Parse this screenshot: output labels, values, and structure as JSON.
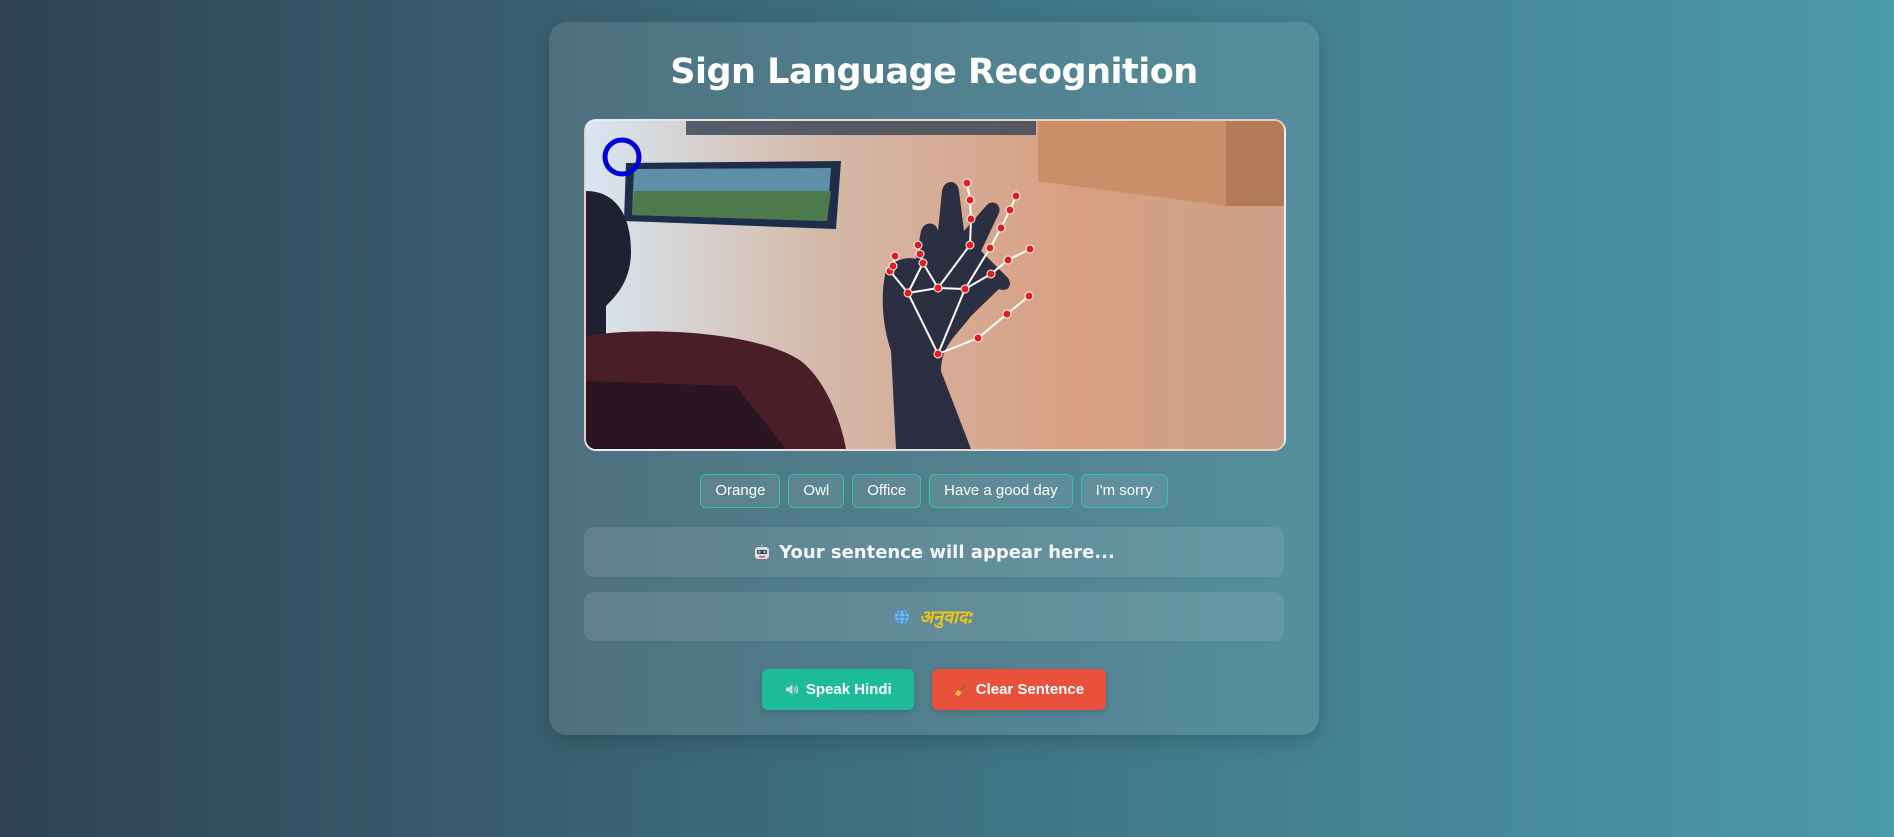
{
  "app": {
    "title": "Sign Language Recognition"
  },
  "video": {
    "indicator_icon": "ring-indicator-icon",
    "content_icon": "hand-landmarks-icon"
  },
  "word_buttons": [
    {
      "label": "Orange"
    },
    {
      "label": "Owl"
    },
    {
      "label": "Office"
    },
    {
      "label": "Have a good day"
    },
    {
      "label": "I'm sorry"
    }
  ],
  "sentence": {
    "icon": "robot-icon",
    "placeholder": "Your sentence will appear here..."
  },
  "translation": {
    "icon": "globe-icon",
    "label": "अनुवाद:"
  },
  "actions": {
    "speak_icon": "speaker-icon",
    "speak_label": "Speak Hindi",
    "clear_icon": "broom-icon",
    "clear_label": "Clear Sentence"
  },
  "colors": {
    "accent_teal": "#1dbb98",
    "danger_red": "#e9513d",
    "translation_gold": "#f2c21c",
    "landmark_red": "#e11d1d",
    "indicator_blue": "#0000dd"
  }
}
